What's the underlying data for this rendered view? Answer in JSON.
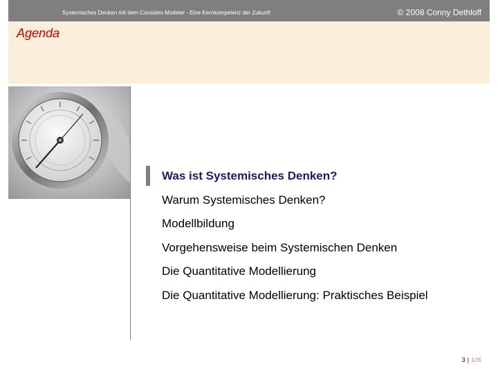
{
  "header": {
    "subtitle": "Systemisches Denken mit dem Consideo Modeler - Eine Kernkompetenz der Zukunft",
    "copyright": "© 2008 Conny Dethloff"
  },
  "slide": {
    "title": "Agenda",
    "image_subject": "barometer-photo"
  },
  "agenda": {
    "items": [
      "Was ist Systemisches Denken?",
      "Warum Systemisches Denken?",
      "Modellbildung",
      "Vorgehensweise beim Systemischen Denken",
      "Die Quantitative Modellierung",
      "Die Quantitative Modellierung: Praktisches Beispiel"
    ],
    "active_index": 0
  },
  "footer": {
    "page": "3",
    "separator": "|",
    "total": "106"
  },
  "colors": {
    "header_bar": "#7f7f7f",
    "title_band": "#fbefdb",
    "title_text": "#cc0000",
    "active_item": "#1a1a66"
  }
}
